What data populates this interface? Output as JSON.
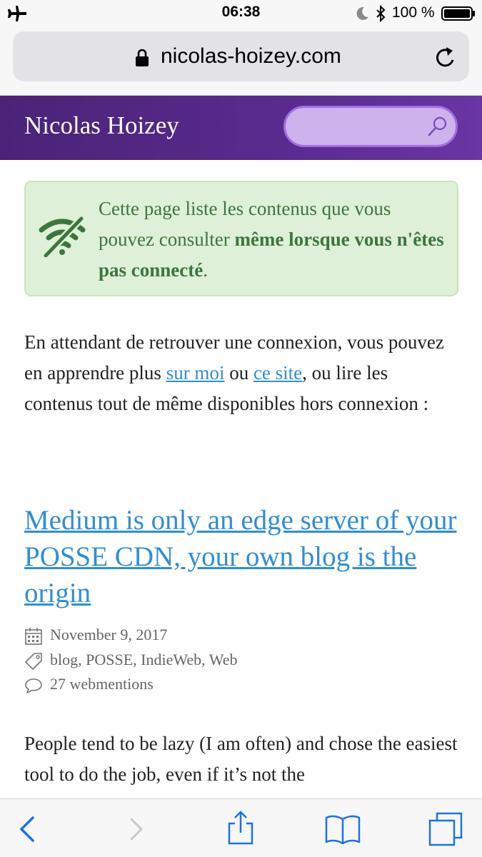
{
  "status_bar": {
    "time": "06:38",
    "battery_percent": "100 %",
    "icons": [
      "airplane-icon",
      "moon-icon",
      "bluetooth-icon",
      "battery-icon"
    ]
  },
  "browser": {
    "url": "nicolas-hoizey.com",
    "icons": [
      "lock-icon",
      "reload-icon"
    ]
  },
  "header": {
    "site_title": "Nicolas Hoizey",
    "search_placeholder": "",
    "brand_color": "#5a2b8f"
  },
  "notice": {
    "text_before": "Cette page liste les contenus que vous pouvez consulter ",
    "text_bold": "même lorsque vous n'êtes pas connecté",
    "text_after": ".",
    "icon": "no-wifi-icon",
    "color": "#3c763d",
    "background": "#dff0d8"
  },
  "intro": {
    "part1": "En attendant de retrouver une connexion, vous pouvez en apprendre plus ",
    "link_about": "sur moi",
    "part2": " ou ",
    "link_site": "ce site",
    "part3": ", ou lire les contenus tout de même disponibles hors connexion :"
  },
  "article": {
    "title": "Medium is only an edge server of your POSSE CDN, your own blog is the origin",
    "date": "November  9, 2017",
    "tags": "blog, POSSE, IndieWeb, Web",
    "webmentions": "27 webmentions",
    "excerpt": "People tend to be lazy (I am often) and chose the easiest tool to do the job, even if it’s not the"
  },
  "toolbar": {
    "icons": [
      "back-icon",
      "forward-icon",
      "share-icon",
      "bookmarks-icon",
      "tabs-icon"
    ]
  },
  "link_color": "#2f8ed6"
}
